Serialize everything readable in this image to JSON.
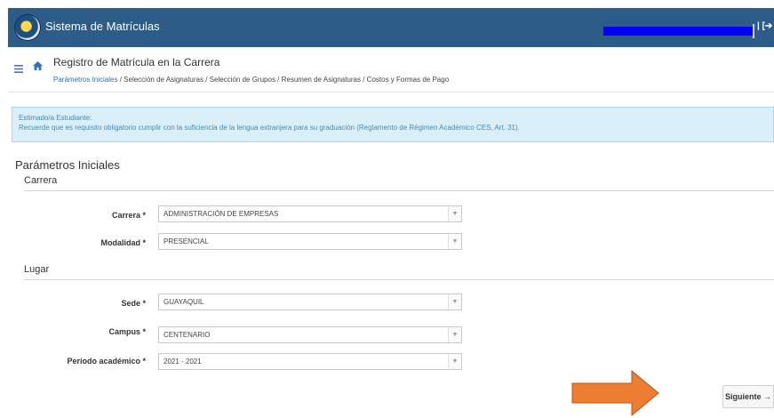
{
  "navbar": {
    "app_title": "Sistema de Matrículas",
    "logout_label": "| [➔ Salir"
  },
  "header": {
    "title": "Registro de Matrícula en la Carrera",
    "breadcrumb": [
      "Parámetros Iniciales",
      "Selección de Asignaturas",
      "Selección de Grupos",
      "Resumen de Asignaturas",
      "Costos y Formas de Pago"
    ],
    "separator": " / "
  },
  "alert": {
    "line1": "Estimado/a Estudiante:",
    "line2": "Recuerde que es requisito obligatorio cumplir con la suficiencia de la lengua extranjera para su graduación (Reglamento de Régimen Académico CES, Art. 31)."
  },
  "form": {
    "title": "Parámetros Iniciales",
    "carrera_section": "Carrera",
    "lugar_section": "Lugar",
    "fields": {
      "carrera": {
        "label": "Carrera *",
        "value": "ADMINISTRACIÓN DE EMPRESAS"
      },
      "modalidad": {
        "label": "Modalidad *",
        "value": "PRESENCIAL"
      },
      "sede": {
        "label": "Sede *",
        "value": "GUAYAQUIL"
      },
      "campus": {
        "label": "Campus *",
        "value": "CENTENARIO"
      },
      "periodo": {
        "label": "Período académico *",
        "value": "2021 - 2021"
      }
    }
  },
  "actions": {
    "next_label": "Siguiente →"
  },
  "colors": {
    "navbar": "#2d5c88",
    "alert_bg": "#d9f0fb",
    "alert_text": "#4a88b0",
    "link": "#2e6fb6",
    "arrow": "#ed7d31",
    "redaction": "#0000ff"
  },
  "icons": {
    "menu": "menu-icon",
    "home": "home-icon",
    "caret": "caret-down-icon",
    "logout": "sign-out-icon"
  }
}
